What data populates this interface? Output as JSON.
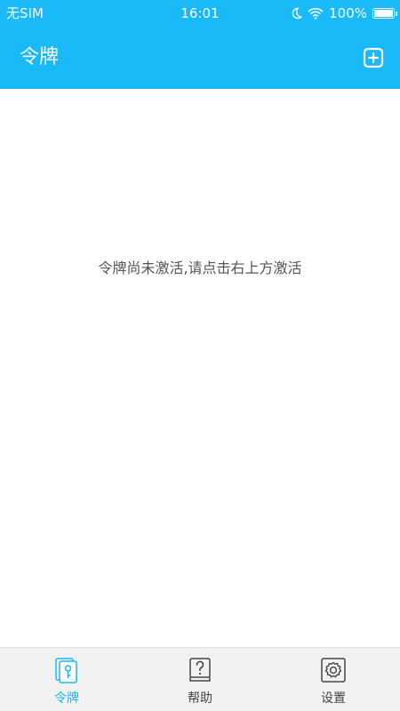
{
  "status_bar": {
    "carrier": "无SIM",
    "time": "16:01",
    "battery": "100%",
    "icons": [
      "moon-icon",
      "wifi-icon",
      "battery-icon"
    ]
  },
  "navbar": {
    "title": "令牌",
    "add_icon": "plus-square-icon"
  },
  "content": {
    "empty_message": "令牌尚未激活,请点击右上方激活"
  },
  "tabs": [
    {
      "label": "令牌",
      "icon": "token-icon",
      "active": true
    },
    {
      "label": "帮助",
      "icon": "help-book-icon",
      "active": false
    },
    {
      "label": "设置",
      "icon": "gear-icon",
      "active": false
    }
  ],
  "colors": {
    "accent": "#1ab9f8",
    "tab_bar_bg": "#f2f2f2",
    "inactive_icon": "#444444"
  }
}
